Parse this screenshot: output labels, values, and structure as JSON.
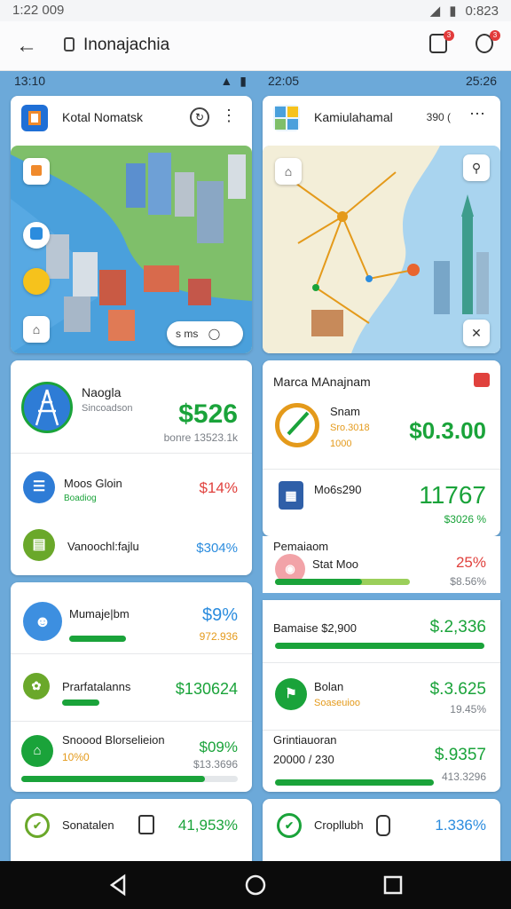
{
  "status": {
    "time": "1:22 009",
    "right": "0:823"
  },
  "appbar": {
    "title": "Inonajachia",
    "badge1": "3",
    "badge2": "3"
  },
  "left_status": {
    "time": "13:10"
  },
  "right_status": {
    "time": "22:05",
    "right": "25:26"
  },
  "left_map": {
    "title": "Kotal Nomatsk",
    "pill": "s ms"
  },
  "right_map": {
    "title": "Kamiulahamal",
    "extra": "390 ("
  },
  "stats_left": {
    "main": {
      "label": "Naogla",
      "sub": "Sincoadson",
      "value": "$526",
      "caption": "bonre 13523.1k"
    },
    "r1": {
      "label": "Moos Gloin",
      "sub": "Boadiog",
      "value": "$14%"
    },
    "r2": {
      "label": "Vanoochl:fajlu",
      "value": "$304%"
    }
  },
  "stats_right": {
    "title": "Marca MAnajnam",
    "main": {
      "label": "Snam",
      "sub1": "Sro.3018",
      "sub2": "1000",
      "value": "$0.3.00"
    },
    "r1": {
      "label": "Mo6s290",
      "value": "11767",
      "caption": "$3026 %"
    },
    "r2": {
      "head": "Pemaiaom",
      "label": "Stat Moo",
      "value": "25%",
      "caption": "$8.56%",
      "progress": 0.48
    }
  },
  "list_left": [
    {
      "label": "Mumaje|bm",
      "value": "$9%",
      "caption": "972.936",
      "progress": 0.62
    },
    {
      "label": "Prarfatalanns",
      "value": "$130624",
      "progress": 0.2
    },
    {
      "label": "Snoood Blorselieion",
      "sub": "10%0",
      "value": "$09%",
      "caption": "$13.3696",
      "progress": 0.85
    }
  ],
  "list_right": [
    {
      "label": "Bamaise $2,900",
      "value": "$.2,336",
      "progress": 1.0
    },
    {
      "label": "Bolan",
      "sub": "Soaseuioo",
      "value": "$.3.625",
      "caption": "19.45%"
    },
    {
      "label": "Grintiauoran",
      "sub": "20000 / 230",
      "value": "$.9357",
      "caption": "413.3296",
      "progress": 0.8
    }
  ],
  "bottom_left": {
    "label": "Sonatalen",
    "value": "41,953%"
  },
  "bottom_right": {
    "label": "Cropllubh",
    "value": "1.336%"
  },
  "colors": {
    "green": "#1aa33a",
    "red": "#e0413d",
    "blue": "#2b8cde",
    "bg": "#6ca9d9"
  },
  "icons": [
    "back-arrow-icon",
    "lock-icon",
    "tab-icon",
    "clock-icon",
    "compass-icon",
    "search-icon",
    "menu-dots-icon",
    "home-icon",
    "pin-icon"
  ]
}
